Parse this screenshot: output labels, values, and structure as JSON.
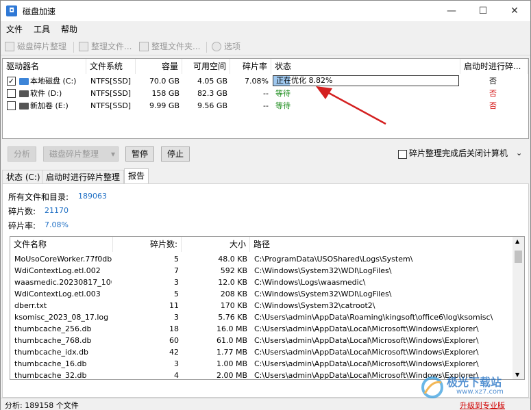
{
  "window": {
    "title": "磁盘加速",
    "minimize": "—",
    "maximize": "☐",
    "close": "✕"
  },
  "menu": [
    "文件",
    "工具",
    "帮助"
  ],
  "toolbar": {
    "defrag_label": "磁盘碎片整理",
    "defrag_file_label": "整理文件...",
    "defrag_folder_label": "整理文件夹...",
    "options_label": "选项"
  },
  "drives": {
    "headers": [
      "驱动器名",
      "文件系统",
      "容量",
      "可用空间",
      "碎片率",
      "状态",
      "启动时进行碎..."
    ],
    "rows": [
      {
        "checked": true,
        "name": "本地磁盘 (C:)",
        "fs": "NTFS[SSD]",
        "capacity": "70.0 GB",
        "free": "4.05 GB",
        "frag": "7.08%",
        "status": "正在优化 8.82%",
        "progress": 0.0882,
        "boot": "否"
      },
      {
        "checked": false,
        "name": "软件 (D:)",
        "fs": "NTFS[SSD]",
        "capacity": "158 GB",
        "free": "82.3 GB",
        "frag": "--",
        "status": "等待",
        "boot": "否"
      },
      {
        "checked": false,
        "name": "新加卷 (E:)",
        "fs": "NTFS[SSD]",
        "capacity": "9.99 GB",
        "free": "9.56 GB",
        "frag": "--",
        "status": "等待",
        "boot": "否"
      }
    ]
  },
  "actions": {
    "analyze_label": "分析",
    "defrag_combo_label": "磁盘碎片整理",
    "pause_label": "暂停",
    "stop_label": "停止",
    "shutdown_label": "碎片整理完成后关闭计算机"
  },
  "tabs": [
    "状态 (C:)",
    "启动时进行碎片整理",
    "报告"
  ],
  "report": {
    "all_files_label": "所有文件和目录:",
    "all_files_value": "189063",
    "frag_count_label": "碎片数:",
    "frag_count_value": "21170",
    "frag_rate_label": "碎片率:",
    "frag_rate_value": "7.08%",
    "headers": [
      "文件名称",
      "碎片数:",
      "大小",
      "路径"
    ],
    "files": [
      {
        "name": "MoUsoCoreWorker.77f0db...",
        "frags": "5",
        "size": "48.0 KB",
        "path": "C:\\ProgramData\\USOShared\\Logs\\System\\"
      },
      {
        "name": "WdiContextLog.etl.002",
        "frags": "7",
        "size": "592 KB",
        "path": "C:\\Windows\\System32\\WDI\\LogFiles\\"
      },
      {
        "name": "waasmedic.20230817_100...",
        "frags": "3",
        "size": "12.0 KB",
        "path": "C:\\Windows\\Logs\\waasmedic\\"
      },
      {
        "name": "WdiContextLog.etl.003",
        "frags": "5",
        "size": "208 KB",
        "path": "C:\\Windows\\System32\\WDI\\LogFiles\\"
      },
      {
        "name": "dberr.txt",
        "frags": "11",
        "size": "170 KB",
        "path": "C:\\Windows\\System32\\catroot2\\"
      },
      {
        "name": "ksomisc_2023_08_17.log",
        "frags": "3",
        "size": "5.76 KB",
        "path": "C:\\Users\\admin\\AppData\\Roaming\\kingsoft\\office6\\log\\ksomisc\\"
      },
      {
        "name": "thumbcache_256.db",
        "frags": "18",
        "size": "16.0 MB",
        "path": "C:\\Users\\admin\\AppData\\Local\\Microsoft\\Windows\\Explorer\\"
      },
      {
        "name": "thumbcache_768.db",
        "frags": "60",
        "size": "61.0 MB",
        "path": "C:\\Users\\admin\\AppData\\Local\\Microsoft\\Windows\\Explorer\\"
      },
      {
        "name": "thumbcache_idx.db",
        "frags": "42",
        "size": "1.77 MB",
        "path": "C:\\Users\\admin\\AppData\\Local\\Microsoft\\Windows\\Explorer\\"
      },
      {
        "name": "thumbcache_16.db",
        "frags": "3",
        "size": "1.00 MB",
        "path": "C:\\Users\\admin\\AppData\\Local\\Microsoft\\Windows\\Explorer\\"
      },
      {
        "name": "thumbcache_32.db",
        "frags": "4",
        "size": "2.00 MB",
        "path": "C:\\Users\\admin\\AppData\\Local\\Microsoft\\Windows\\Explorer\\"
      }
    ]
  },
  "statusbar": {
    "text": "分析: 189158 个文件",
    "upgrade_label": "升级到专业版"
  },
  "watermark": {
    "text": "极光下载站",
    "url": "www.xz7.com"
  },
  "colors": {
    "accent": "#1f6fc4",
    "waiting": "#1b8c1b",
    "no": "#d00000",
    "progress": "#9ec7ee",
    "arrow": "#d42020"
  }
}
